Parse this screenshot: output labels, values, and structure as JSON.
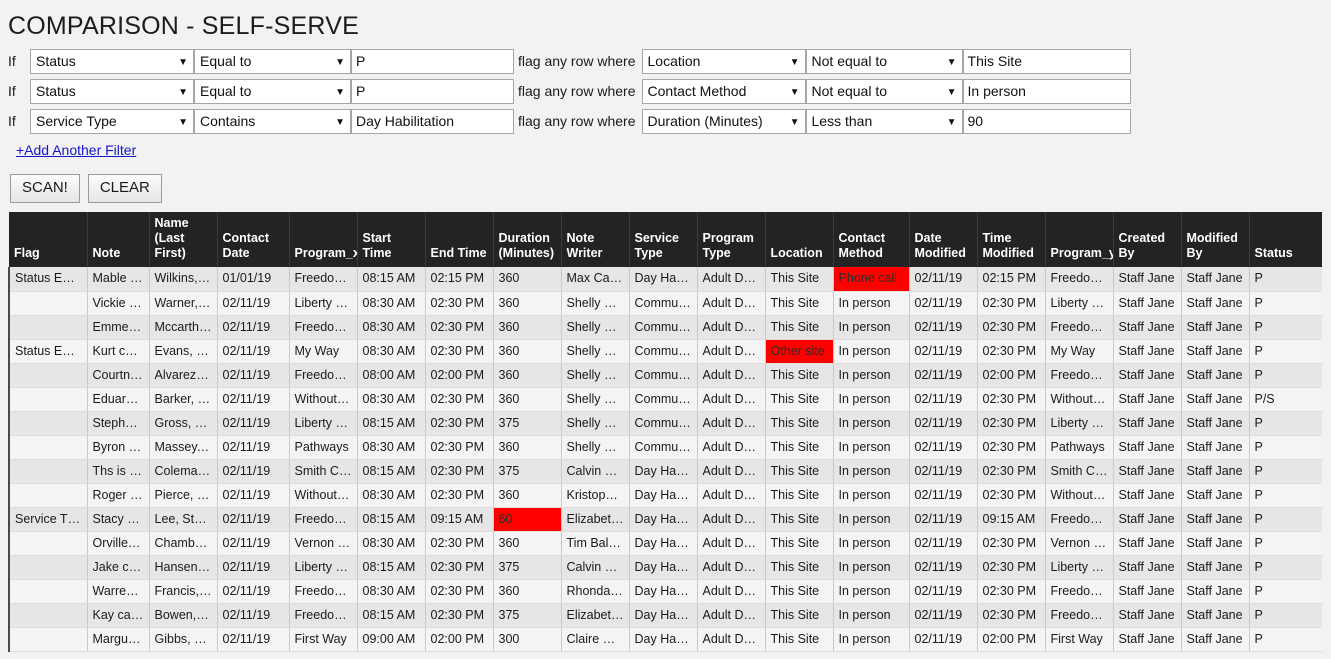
{
  "page": {
    "title": "COMPARISON - SELF-SERVE",
    "add_filter_label": "+Add Another Filter",
    "if_label": "If",
    "flag_label": "flag any row where"
  },
  "filters": [
    {
      "field": "Status",
      "operator": "Equal to",
      "value": "P",
      "flag_field": "Location",
      "flag_operator": "Not equal to",
      "flag_value": "This Site"
    },
    {
      "field": "Status",
      "operator": "Equal to",
      "value": "P",
      "flag_field": "Contact Method",
      "flag_operator": "Not equal to",
      "flag_value": "In person"
    },
    {
      "field": "Service Type",
      "operator": "Contains",
      "value": "Day Habilitation",
      "flag_field": "Duration (Minutes)",
      "flag_operator": "Less than",
      "flag_value": "90"
    }
  ],
  "buttons": {
    "scan": "SCAN!",
    "clear": "CLEAR"
  },
  "colors": {
    "header_bg": "#232323",
    "highlight": "#ff0000",
    "link": "#1616c8",
    "page_bg": "#f2f2f2"
  },
  "table": {
    "columns": [
      "Flag",
      "Note",
      "Name (Last First)",
      "Contact Date",
      "Program_x",
      "Start Time",
      "End Time",
      "Duration (Minutes)",
      "Note Writer",
      "Service Type",
      "Program Type",
      "Location",
      "Contact Method",
      "Date Modified",
      "Time Modified",
      "Program_y",
      "Created By",
      "Modified By",
      "Status"
    ],
    "rows": [
      {
        "cells": [
          "Status Eq…",
          "Mable ca…",
          "Wilkins, …",
          "01/01/19",
          "Freedom …",
          "08:15 AM",
          "02:15 PM",
          "360",
          "Max Carl…",
          "Day Habil…",
          "Adult Day…",
          "This Site",
          "Phone call",
          "02/11/19",
          "02:15 PM",
          "Freedom …",
          "Staff Jane",
          "Staff Jane",
          "P"
        ],
        "highlight": [
          12
        ]
      },
      {
        "cells": [
          "",
          "Vickie ca…",
          "Warner, V…",
          "02/11/19",
          "Liberty St…",
          "08:30 AM",
          "02:30 PM",
          "360",
          "Shelly Sa…",
          "Communi…",
          "Adult Day…",
          "This Site",
          "In person",
          "02/11/19",
          "02:30 PM",
          "Liberty St…",
          "Staff Jane",
          "Staff Jane",
          "P"
        ],
        "highlight": []
      },
      {
        "cells": [
          "",
          "Emmett c…",
          "Mccarthy…",
          "02/11/19",
          "Freedom …",
          "08:30 AM",
          "02:30 PM",
          "360",
          "Shelly Sa…",
          "Communi…",
          "Adult Day…",
          "This Site",
          "In person",
          "02/11/19",
          "02:30 PM",
          "Freedom …",
          "Staff Jane",
          "Staff Jane",
          "P"
        ],
        "highlight": []
      },
      {
        "cells": [
          "Status Eq…",
          "Kurt cam…",
          "Evans, Kurt",
          "02/11/19",
          "My Way",
          "08:30 AM",
          "02:30 PM",
          "360",
          "Shelly Sa…",
          "Communi…",
          "Adult Day…",
          "Other site",
          "In person",
          "02/11/19",
          "02:30 PM",
          "My Way",
          "Staff Jane",
          "Staff Jane",
          "P"
        ],
        "highlight": [
          11
        ]
      },
      {
        "cells": [
          "",
          "Courtney …",
          "Alvarez, …",
          "02/11/19",
          "Freedom …",
          "08:00 AM",
          "02:00 PM",
          "360",
          "Shelly Sa…",
          "Communi…",
          "Adult Day…",
          "This Site",
          "In person",
          "02/11/19",
          "02:00 PM",
          "Freedom …",
          "Staff Jane",
          "Staff Jane",
          "P"
        ],
        "highlight": []
      },
      {
        "cells": [
          "",
          "Eduardo …",
          "Barker, E…",
          "02/11/19",
          "Without …",
          "08:30 AM",
          "02:30 PM",
          "360",
          "Shelly Sa…",
          "Communi…",
          "Adult Day…",
          "This Site",
          "In person",
          "02/11/19",
          "02:30 PM",
          "Without …",
          "Staff Jane",
          "Staff Jane",
          "P/S"
        ],
        "highlight": []
      },
      {
        "cells": [
          "",
          "Stephen …",
          "Gross, St…",
          "02/11/19",
          "Liberty St…",
          "08:15 AM",
          "02:30 PM",
          "375",
          "Shelly Sa…",
          "Communi…",
          "Adult Day…",
          "This Site",
          "In person",
          "02/11/19",
          "02:30 PM",
          "Liberty St…",
          "Staff Jane",
          "Staff Jane",
          "P"
        ],
        "highlight": []
      },
      {
        "cells": [
          "",
          "Byron ca…",
          "Massey, …",
          "02/11/19",
          "Pathways",
          "08:30 AM",
          "02:30 PM",
          "360",
          "Shelly Sa…",
          "Communi…",
          "Adult Day…",
          "This Site",
          "In person",
          "02/11/19",
          "02:30 PM",
          "Pathways",
          "Staff Jane",
          "Staff Jane",
          "P"
        ],
        "highlight": []
      },
      {
        "cells": [
          "",
          "Ths is jus…",
          "Coleman,…",
          "02/11/19",
          "Smith Ce…",
          "08:15 AM",
          "02:30 PM",
          "375",
          "Calvin Ro…",
          "Day Habil…",
          "Adult Day…",
          "This Site",
          "In person",
          "02/11/19",
          "02:30 PM",
          "Smith Ce…",
          "Staff Jane",
          "Staff Jane",
          "P"
        ],
        "highlight": []
      },
      {
        "cells": [
          "",
          "Roger ca…",
          "Pierce, R…",
          "02/11/19",
          "Without …",
          "08:30 AM",
          "02:30 PM",
          "360",
          "Kristophe…",
          "Day Habil…",
          "Adult Day…",
          "This Site",
          "In person",
          "02/11/19",
          "02:30 PM",
          "Without …",
          "Staff Jane",
          "Staff Jane",
          "P"
        ],
        "highlight": []
      },
      {
        "cells": [
          "Service T…",
          "Stacy ca…",
          "Lee, Stacy",
          "02/11/19",
          "Freedom …",
          "08:15 AM",
          "09:15 AM",
          "60",
          "Elizabeth …",
          "Day Habil…",
          "Adult Day…",
          "This Site",
          "In person",
          "02/11/19",
          "09:15 AM",
          "Freedom …",
          "Staff Jane",
          "Staff Jane",
          "P"
        ],
        "highlight": [
          7
        ]
      },
      {
        "cells": [
          "",
          "Orville ca…",
          "Chamber…",
          "02/11/19",
          "Vernon C…",
          "08:30 AM",
          "02:30 PM",
          "360",
          "Tim Bald…",
          "Day Habil…",
          "Adult Day…",
          "This Site",
          "In person",
          "02/11/19",
          "02:30 PM",
          "Vernon C…",
          "Staff Jane",
          "Staff Jane",
          "P"
        ],
        "highlight": []
      },
      {
        "cells": [
          "",
          "Jake cam…",
          "Hansen, …",
          "02/11/19",
          "Liberty St…",
          "08:15 AM",
          "02:30 PM",
          "375",
          "Calvin Ro…",
          "Day Habil…",
          "Adult Day…",
          "This Site",
          "In person",
          "02/11/19",
          "02:30 PM",
          "Liberty St…",
          "Staff Jane",
          "Staff Jane",
          "P"
        ],
        "highlight": []
      },
      {
        "cells": [
          "",
          "Warren c…",
          "Francis, …",
          "02/11/19",
          "Freedom …",
          "08:30 AM",
          "02:30 PM",
          "360",
          "Rhonda K…",
          "Day Habil…",
          "Adult Day…",
          "This Site",
          "In person",
          "02/11/19",
          "02:30 PM",
          "Freedom …",
          "Staff Jane",
          "Staff Jane",
          "P"
        ],
        "highlight": []
      },
      {
        "cells": [
          "",
          "Kay came…",
          "Bowen, K…",
          "02/11/19",
          "Freedom …",
          "08:15 AM",
          "02:30 PM",
          "375",
          "Elizabeth …",
          "Day Habil…",
          "Adult Day…",
          "This Site",
          "In person",
          "02/11/19",
          "02:30 PM",
          "Freedom …",
          "Staff Jane",
          "Staff Jane",
          "P"
        ],
        "highlight": []
      },
      {
        "cells": [
          "",
          "Marguerit…",
          "Gibbs, M…",
          "02/11/19",
          "First Way",
          "09:00 AM",
          "02:00 PM",
          "300",
          "Claire Ma…",
          "Day Habil…",
          "Adult Day…",
          "This Site",
          "In person",
          "02/11/19",
          "02:00 PM",
          "First Way",
          "Staff Jane",
          "Staff Jane",
          "P"
        ],
        "highlight": []
      }
    ]
  }
}
